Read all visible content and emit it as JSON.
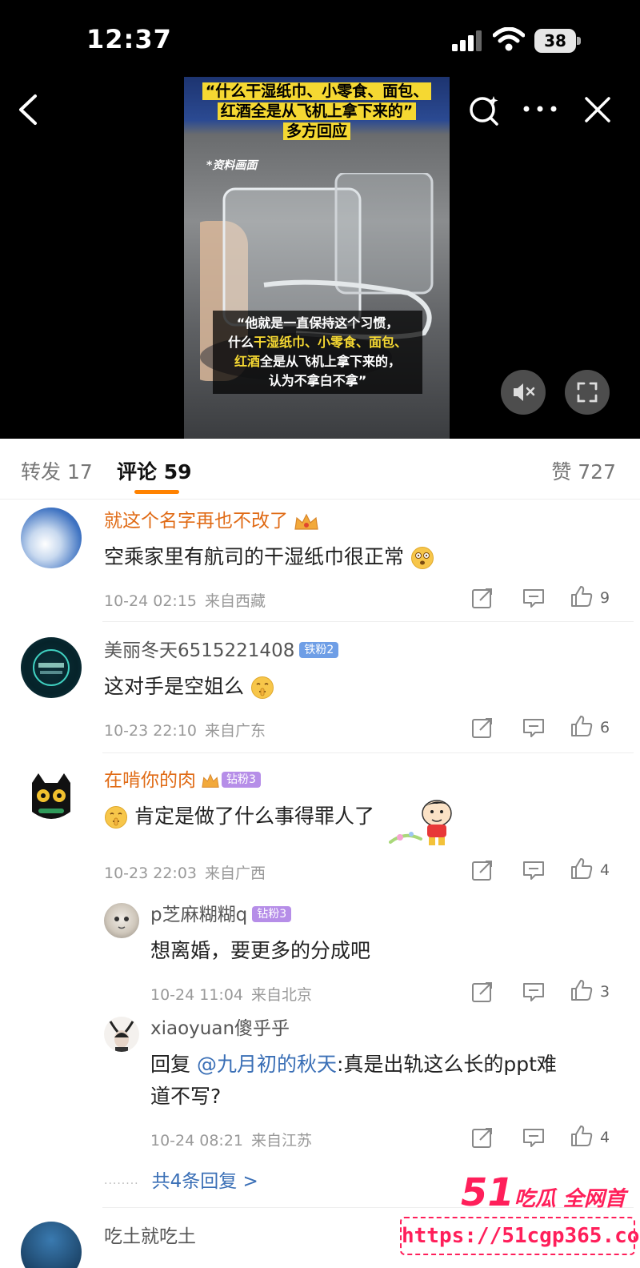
{
  "status_bar": {
    "time": "12:37",
    "battery": "38"
  },
  "video": {
    "title_line1": "“什么干湿纸巾、小零食、面包、",
    "title_line2": "红酒全是从飞机上拿下来的”",
    "title_line3": "多方回应",
    "watermark": "*资料画面",
    "caption_line1": "“他就是一直保持这个习惯，",
    "caption_line2_prefix": "什么",
    "caption_line2_highlight": "干湿纸巾、小零食、面包、",
    "caption_line3_highlight": "红酒",
    "caption_line3_suffix": "全是从飞机上拿下来的，",
    "caption_line4": "认为不拿白不拿”"
  },
  "tabs": {
    "repost": "转发 17",
    "comments": "评论 59",
    "likes": "赞 727"
  },
  "comments": [
    {
      "user": "就这个名字再也不改了",
      "text": "空乘家里有航司的干湿纸巾很正常",
      "time": "10-24 02:15",
      "location": "来自西藏",
      "likes": "9"
    },
    {
      "user": "美丽冬天6515221408",
      "badge": "铁粉2",
      "text": "这对手是空姐么",
      "time": "10-23 22:10",
      "location": "来自广东",
      "likes": "6"
    },
    {
      "user": "在啃你的肉",
      "badge": "钻粉3",
      "text": "肯定是做了什么事得罪人了",
      "time": "10-23 22:03",
      "location": "来自广西",
      "likes": "4"
    }
  ],
  "replies": [
    {
      "user": "p芝麻糊糊q",
      "badge": "钻粉3",
      "text": "想离婚，要更多的分成吧",
      "time": "10-24 11:04",
      "location": "来自北京",
      "likes": "3"
    },
    {
      "user": "xiaoyuan傻乎乎",
      "text_prefix": "回复 ",
      "mention": "@九月初的秋天",
      "text_line1": ":真是出轨这么长的ppt难",
      "text_line2": "道不写?",
      "time": "10-24 08:21",
      "location": "来自江苏",
      "likes": "4"
    }
  ],
  "more_replies": "共4条回复 >",
  "next_comment_user": "吃土就吃土",
  "watermark": {
    "brand_num": "51",
    "brand_text": "吃瓜 全网首发",
    "url": "https://51cgp365.com"
  }
}
